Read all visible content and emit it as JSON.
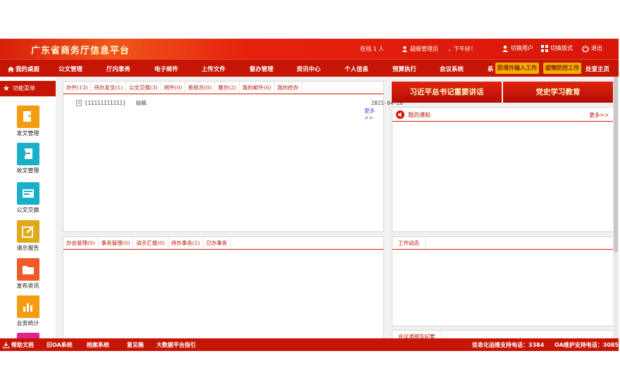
{
  "header": {
    "title": "广东省商务厅信息平台",
    "online": "在线 1 人",
    "user": "超级管理员",
    "greeting": "，下午好！",
    "switch_user": "切换用户",
    "switch_layout": "切换版式",
    "logout": "退出"
  },
  "nav": {
    "items": [
      "我的桌面",
      "公文管理",
      "厅内事务",
      "电子邮件",
      "上传文件",
      "督办管理",
      "资讯中心",
      "个人信息",
      "预算执行",
      "会议系统",
      "系"
    ],
    "tags": [
      "防境外输入工作",
      "疫情防控工作"
    ],
    "home": "处室主页"
  },
  "sidebar": {
    "title": "功能菜单",
    "items": [
      "发文管理",
      "收文管理",
      "公文交换",
      "请示报告",
      "发布资讯",
      "业务统计"
    ],
    "colors": [
      "#f39c12",
      "#1ab0c9",
      "#1ab0c9",
      "#e0a81a",
      "#f05a28",
      "#f39c12"
    ]
  },
  "top_panel": {
    "tabs": [
      "办件(13)",
      "待办发文(1)",
      "公文交换(3)",
      "阅件(0)",
      "新批示(0)",
      "督办(2)",
      "我的邮件(6)",
      "我的经办"
    ],
    "doc_id": "[11111111111]",
    "doc_title": "拟稿",
    "doc_date": "2021-04-20",
    "more": "更多>>"
  },
  "banners": [
    "习近平总书记重要讲话",
    "党史学习教育"
  ],
  "notice": {
    "title": "我的通知",
    "more": "更多>>"
  },
  "bottom_panel": {
    "tabs": [
      "办会管理(0)",
      "事务管理(0)",
      "请示汇报(0)",
      "待办事务(2)",
      "已办事务"
    ]
  },
  "work": {
    "title": "工作动态"
  },
  "meeting": {
    "title": "会议通报及纪要"
  },
  "footer": {
    "help": "帮助文档",
    "old_oa": "旧OA系统",
    "archive": "档案系统",
    "feedback": "意见箱",
    "bigdata": "大数据平台指引",
    "it_support": "信息化运维支持电话：3384",
    "oa_support": "OA维护支持电话：3085"
  }
}
